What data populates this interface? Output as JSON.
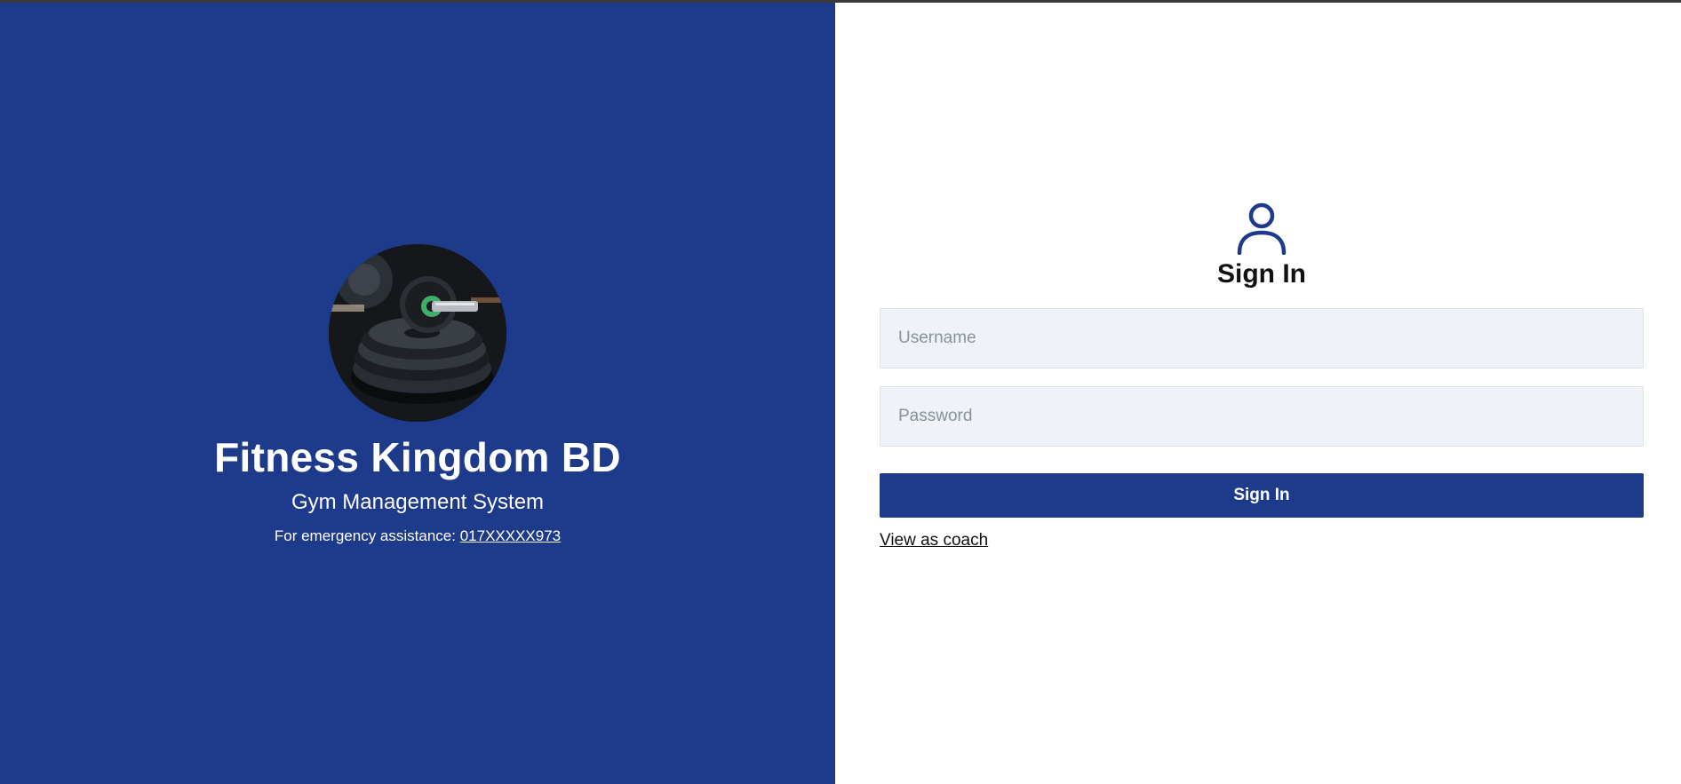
{
  "brand": {
    "title": "Fitness Kingdom BD",
    "subtitle": "Gym Management System",
    "emergency_label": "For emergency assistance:",
    "emergency_phone": "017XXXXX973",
    "logo_image": "gym-weight-plates-photo"
  },
  "signin": {
    "icon": "user-icon",
    "title": "Sign In",
    "username_placeholder": "Username",
    "password_placeholder": "Password",
    "submit_label": "Sign In",
    "coach_link": "View as coach"
  },
  "colors": {
    "brand_blue": "#1e3a8a",
    "field_bg": "#eff2f6",
    "text_dark": "#111111"
  }
}
